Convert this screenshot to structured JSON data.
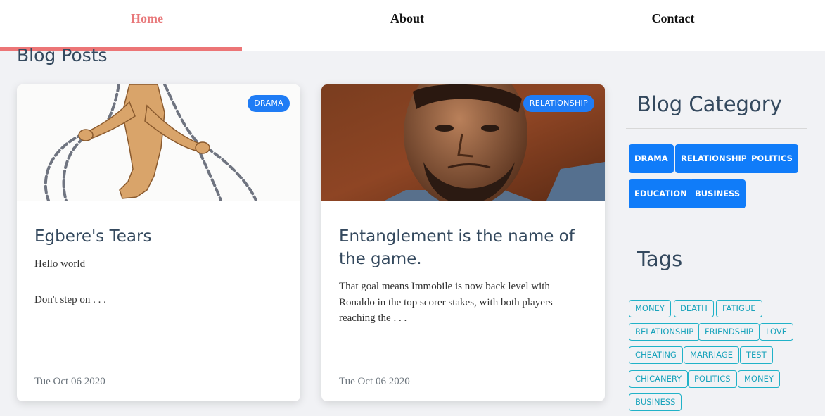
{
  "nav": {
    "home": "Home",
    "about": "About",
    "contact": "Contact"
  },
  "section_title": "Blog Posts",
  "posts": [
    {
      "category": "DRAMA",
      "title": "Egbere's Tears",
      "lines": [
        "Hello world",
        "Don't step on . . ."
      ],
      "date": "Tue Oct 06 2020"
    },
    {
      "category": "RELATIONSHIP",
      "title": "Entanglement is the name of the game.",
      "lines": [
        "That goal means Immobile is now back level with Ronaldo in the top scorer stakes, with both players reaching the . . ."
      ],
      "date": "Tue Oct 06 2020"
    }
  ],
  "sidebar": {
    "category_heading": "Blog Category",
    "categories": [
      "DRAMA",
      "RELATIONSHIP",
      "POLITICS",
      "EDUCATION",
      "BUSINESS"
    ],
    "tags_heading": "Tags",
    "tags": [
      "MONEY",
      "DEATH",
      "FATIGUE",
      "RELATIONSHIP",
      "FRIENDSHIP",
      "LOVE",
      "CHEATING",
      "MARRIAGE",
      "TEST",
      "CHICANERY",
      "POLITICS",
      "MONEY",
      "BUSINESS"
    ]
  },
  "colors": {
    "nav_active": "#e8787a",
    "accent_blue": "#107cf9",
    "tag_teal": "#1aa3bb",
    "title_slate": "#34495e"
  }
}
